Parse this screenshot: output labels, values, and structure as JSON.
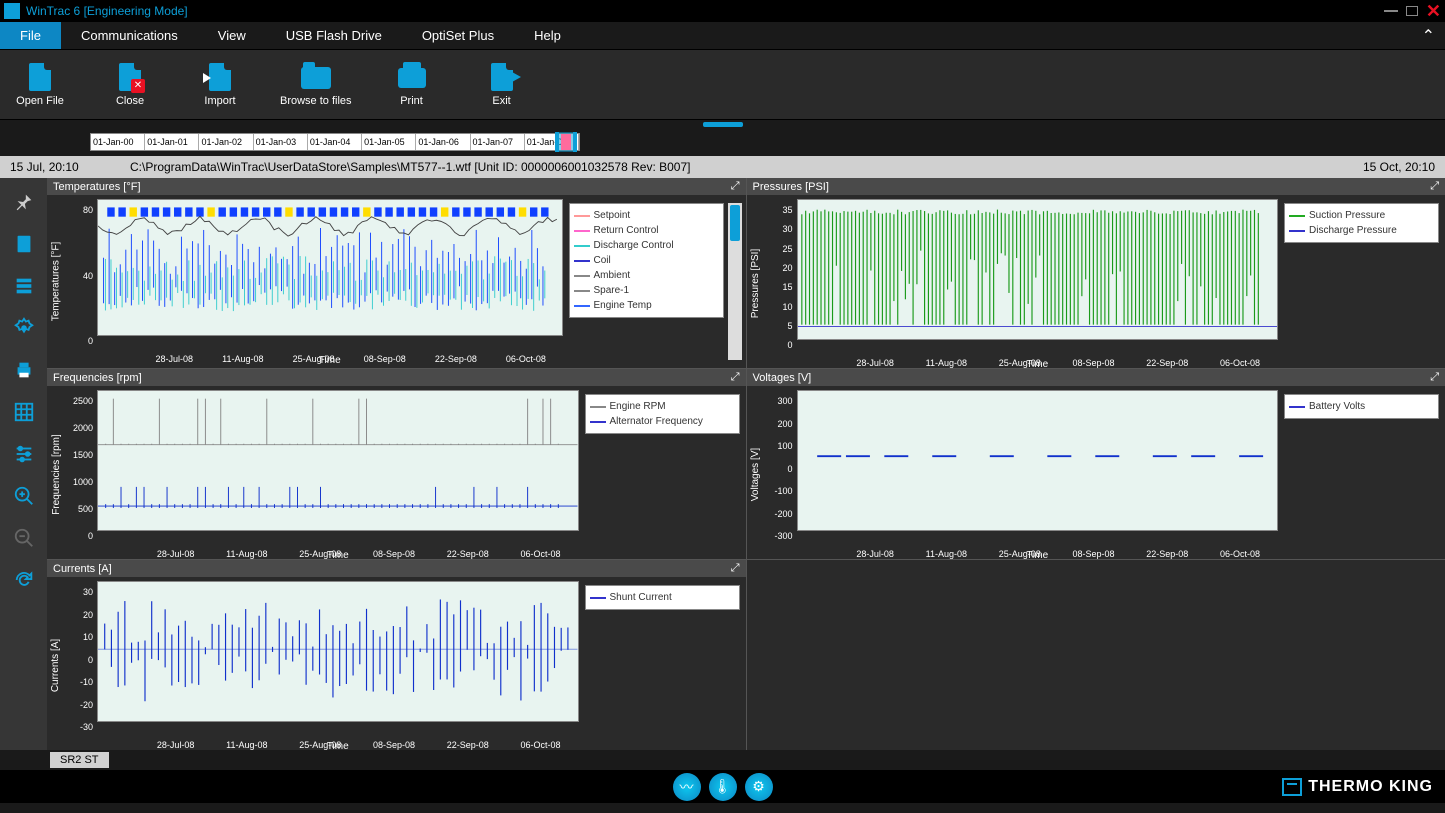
{
  "window": {
    "title": "WinTrac 6 [Engineering Mode]"
  },
  "menu": {
    "items": [
      "File",
      "Communications",
      "View",
      "USB Flash Drive",
      "OptiSet Plus",
      "Help"
    ],
    "active_index": 0
  },
  "ribbon": {
    "buttons": [
      {
        "id": "open",
        "label": "Open File"
      },
      {
        "id": "close",
        "label": "Close"
      },
      {
        "id": "import",
        "label": "Import"
      },
      {
        "id": "browse",
        "label": "Browse to files"
      },
      {
        "id": "print",
        "label": "Print"
      },
      {
        "id": "exit",
        "label": "Exit"
      }
    ]
  },
  "timeline": {
    "segments": [
      "01-Jan-00",
      "01-Jan-01",
      "01-Jan-02",
      "01-Jan-03",
      "01-Jan-04",
      "01-Jan-05",
      "01-Jan-06",
      "01-Jan-07",
      "01-Jan-08"
    ]
  },
  "info": {
    "left_timestamp": "15 Jul, 20:10",
    "path": "C:\\ProgramData\\WinTrac\\UserDataStore\\Samples\\MT577--1.wtf   [Unit ID: 0000006001032578    Rev: B007]",
    "right_timestamp": "15 Oct, 20:10"
  },
  "charts": [
    {
      "id": "temps",
      "title": "Temperatures [°F]",
      "ylabel": "Temperatures [°F]",
      "xlabel": "Time",
      "yticks": [
        "80",
        "40",
        "0"
      ],
      "xticks": [
        "28-Jul-08",
        "11-Aug-08",
        "25-Aug-08",
        "08-Sep-08",
        "22-Sep-08",
        "06-Oct-08"
      ],
      "legend": [
        {
          "name": "Setpoint",
          "color": "#ff9999"
        },
        {
          "name": "Return Control",
          "color": "#ff66cc"
        },
        {
          "name": "Discharge Control",
          "color": "#33cccc"
        },
        {
          "name": "Coil",
          "color": "#3333cc"
        },
        {
          "name": "Ambient",
          "color": "#888888"
        },
        {
          "name": "Spare-1",
          "color": "#888888"
        },
        {
          "name": "Engine Temp",
          "color": "#3366ff"
        }
      ],
      "scrollable_legend": true
    },
    {
      "id": "press",
      "title": "Pressures [PSI]",
      "ylabel": "Pressures [PSI]",
      "xlabel": "Time",
      "yticks": [
        "35",
        "30",
        "25",
        "20",
        "15",
        "10",
        "5",
        "0"
      ],
      "xticks": [
        "28-Jul-08",
        "11-Aug-08",
        "25-Aug-08",
        "08-Sep-08",
        "22-Sep-08",
        "06-Oct-08"
      ],
      "legend": [
        {
          "name": "Suction Pressure",
          "color": "#22aa22"
        },
        {
          "name": "Discharge Pressure",
          "color": "#3333cc"
        }
      ]
    },
    {
      "id": "freq",
      "title": "Frequencies [rpm]",
      "ylabel": "Frequencies [rpm]",
      "xlabel": "Time",
      "yticks": [
        "2500",
        "2000",
        "1500",
        "1000",
        "500",
        "0"
      ],
      "xticks": [
        "28-Jul-08",
        "11-Aug-08",
        "25-Aug-08",
        "08-Sep-08",
        "22-Sep-08",
        "06-Oct-08"
      ],
      "legend": [
        {
          "name": "Engine RPM",
          "color": "#888888"
        },
        {
          "name": "Alternator Frequency",
          "color": "#3333cc"
        }
      ]
    },
    {
      "id": "volt",
      "title": "Voltages [V]",
      "ylabel": "Voltages [V]",
      "xlabel": "Time",
      "yticks": [
        "300",
        "200",
        "100",
        "0",
        "-100",
        "-200",
        "-300"
      ],
      "xticks": [
        "28-Jul-08",
        "11-Aug-08",
        "25-Aug-08",
        "08-Sep-08",
        "22-Sep-08",
        "06-Oct-08"
      ],
      "legend": [
        {
          "name": "Battery Volts",
          "color": "#3333cc"
        }
      ]
    },
    {
      "id": "curr",
      "title": "Currents [A]",
      "ylabel": "Currents [A]",
      "xlabel": "Time",
      "yticks": [
        "30",
        "20",
        "10",
        "0",
        "-10",
        "-20",
        "-30"
      ],
      "xticks": [
        "28-Jul-08",
        "11-Aug-08",
        "25-Aug-08",
        "08-Sep-08",
        "22-Sep-08",
        "06-Oct-08"
      ],
      "legend": [
        {
          "name": "Shunt Current",
          "color": "#3333cc"
        }
      ]
    }
  ],
  "chart_data": [
    {
      "type": "line",
      "title": "Temperatures [°F]",
      "xlabel": "Time",
      "ylabel": "Temperatures [°F]",
      "ylim": [
        0,
        90
      ],
      "categories": [
        "28-Jul-08",
        "11-Aug-08",
        "25-Aug-08",
        "08-Sep-08",
        "22-Sep-08",
        "06-Oct-08"
      ],
      "series": [
        {
          "name": "Setpoint",
          "values": [
            35,
            35,
            35,
            35,
            35,
            35
          ]
        },
        {
          "name": "Return Control",
          "values": [
            40,
            38,
            42,
            36,
            40,
            38
          ]
        },
        {
          "name": "Discharge Control",
          "values": [
            20,
            22,
            18,
            25,
            20,
            22
          ]
        },
        {
          "name": "Coil",
          "values": [
            30,
            28,
            32,
            26,
            30,
            28
          ]
        },
        {
          "name": "Ambient",
          "values": [
            80,
            82,
            78,
            75,
            70,
            65
          ]
        },
        {
          "name": "Spare-1",
          "values": [
            0,
            0,
            0,
            0,
            0,
            0
          ]
        },
        {
          "name": "Engine Temp",
          "values": [
            60,
            58,
            62,
            55,
            60,
            58
          ]
        }
      ]
    },
    {
      "type": "line",
      "title": "Pressures [PSI]",
      "xlabel": "Time",
      "ylabel": "Pressures [PSI]",
      "ylim": [
        0,
        35
      ],
      "categories": [
        "28-Jul-08",
        "11-Aug-08",
        "25-Aug-08",
        "08-Sep-08",
        "22-Sep-08",
        "06-Oct-08"
      ],
      "series": [
        {
          "name": "Suction Pressure",
          "values": [
            18,
            20,
            15,
            22,
            18,
            20
          ]
        },
        {
          "name": "Discharge Pressure",
          "values": [
            0,
            0,
            0,
            0,
            0,
            0
          ]
        }
      ]
    },
    {
      "type": "line",
      "title": "Frequencies [rpm]",
      "xlabel": "Time",
      "ylabel": "Frequencies [rpm]",
      "ylim": [
        0,
        2500
      ],
      "categories": [
        "28-Jul-08",
        "11-Aug-08",
        "25-Aug-08",
        "08-Sep-08",
        "22-Sep-08",
        "06-Oct-08"
      ],
      "series": [
        {
          "name": "Engine RPM",
          "values": [
            1500,
            1500,
            1500,
            1500,
            1500,
            1500
          ]
        },
        {
          "name": "Alternator Frequency",
          "values": [
            250,
            250,
            250,
            250,
            250,
            250
          ]
        }
      ]
    },
    {
      "type": "line",
      "title": "Voltages [V]",
      "xlabel": "Time",
      "ylabel": "Voltages [V]",
      "ylim": [
        -300,
        300
      ],
      "categories": [
        "28-Jul-08",
        "11-Aug-08",
        "25-Aug-08",
        "08-Sep-08",
        "22-Sep-08",
        "06-Oct-08"
      ],
      "series": [
        {
          "name": "Battery Volts",
          "values": [
            14,
            14,
            14,
            14,
            14,
            14
          ]
        }
      ]
    },
    {
      "type": "line",
      "title": "Currents [A]",
      "xlabel": "Time",
      "ylabel": "Currents [A]",
      "ylim": [
        -30,
        30
      ],
      "categories": [
        "28-Jul-08",
        "11-Aug-08",
        "25-Aug-08",
        "08-Sep-08",
        "22-Sep-08",
        "06-Oct-08"
      ],
      "series": [
        {
          "name": "Shunt Current",
          "values": [
            5,
            0,
            8,
            -5,
            3,
            0
          ]
        }
      ]
    }
  ],
  "tabs": {
    "active": "SR2 ST"
  },
  "brand": "THERMO KING"
}
